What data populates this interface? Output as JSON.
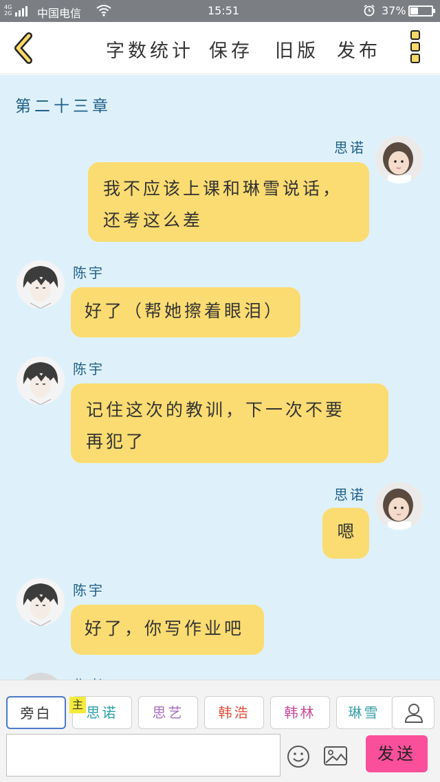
{
  "status_bar": {
    "network": "4G 2G",
    "carrier": "中国电信",
    "time": "15:51",
    "battery_percent": "37%",
    "battery_level": 0.37
  },
  "top_bar": {
    "actions": [
      "字数统计",
      "保存",
      "旧版",
      "发布"
    ]
  },
  "chat": {
    "chapter_title": "第二十三章",
    "messages": [
      {
        "sender": "思诺",
        "side": "right",
        "text_lines": [
          "我不应该上课和琳雪说话，",
          "还考这么差"
        ]
      },
      {
        "sender": "陈宇",
        "side": "left",
        "text_lines": [
          "好了（帮她擦着眼泪）"
        ]
      },
      {
        "sender": "陈宇",
        "side": "left",
        "text_lines": [
          "记住这次的教训，下一次不要",
          "再犯了"
        ]
      },
      {
        "sender": "思诺",
        "side": "right",
        "text_lines": [
          "嗯"
        ]
      },
      {
        "sender": "陈宇",
        "side": "left",
        "text_lines": [
          "好了，你写作业吧"
        ]
      }
    ],
    "partial_sender": "作者"
  },
  "bottom": {
    "roles": [
      {
        "label": "旁白",
        "color": "#333333",
        "selected": true
      },
      {
        "label": "思诺",
        "color": "#2aa0a8",
        "selected": false,
        "tag": "主"
      },
      {
        "label": "思艺",
        "color": "#a86fc0",
        "selected": false
      },
      {
        "label": "韩浩",
        "color": "#e0503c",
        "selected": false
      },
      {
        "label": "韩林",
        "color": "#c9499a",
        "selected": false
      },
      {
        "label": "琳雪",
        "color": "#3aa0a8",
        "selected": false
      }
    ],
    "input_placeholder": "",
    "send_label": "发送"
  },
  "colors": {
    "chat_background": "#def1fb",
    "bubble": "#fbdc72",
    "send_button": "#fa4f9a",
    "accent_icon": "#f7d96a"
  }
}
